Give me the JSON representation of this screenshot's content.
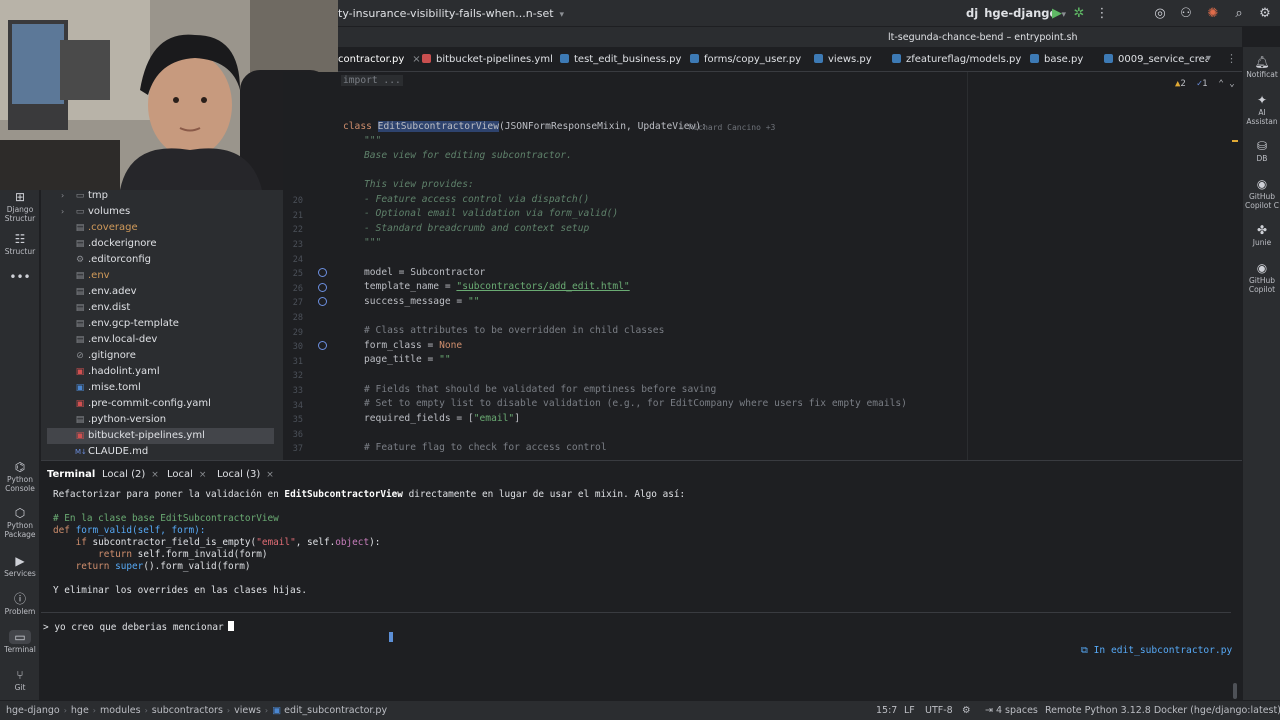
{
  "titlebar": {
    "branch": "ty-insurance-visibility-fails-when...n-set",
    "project_badge": "dj",
    "project": "hge-django",
    "run_config_hint": "lt-segunda-chance-bend – entrypoint.sh"
  },
  "file_tabs": [
    {
      "label": "contractor.py",
      "active": true
    },
    {
      "label": "bitbucket-pipelines.yml"
    },
    {
      "label": "test_edit_business.py"
    },
    {
      "label": "forms/copy_user.py"
    },
    {
      "label": "views.py"
    },
    {
      "label": "zfeatureflag/models.py"
    },
    {
      "label": "base.py"
    },
    {
      "label": "0009_service_crea"
    }
  ],
  "right_tools": [
    {
      "icon": "bell-icon",
      "label": "Notificat"
    },
    {
      "icon": "ai-assistant-icon",
      "label": "AI Assistan"
    },
    {
      "icon": "database-icon",
      "label": "DB"
    },
    {
      "icon": "copilot-icon",
      "label": "GitHub Copilot C"
    },
    {
      "icon": "junie-icon",
      "label": "Junie"
    },
    {
      "icon": "copilot-icon",
      "label": "GitHub Copilot"
    }
  ],
  "left_tools": [
    {
      "icon": "django-icon",
      "label": "Django Structur"
    },
    {
      "icon": "structure-icon",
      "label": "Structur"
    },
    {
      "icon": "more-icon",
      "label": ""
    },
    {
      "icon": "python-console-icon",
      "label": "Python Console"
    },
    {
      "icon": "python-package-icon",
      "label": "Python Package"
    },
    {
      "icon": "services-icon",
      "label": "Services"
    },
    {
      "icon": "problems-icon",
      "label": "Problem"
    },
    {
      "icon": "terminal-icon",
      "label": "Terminal"
    },
    {
      "icon": "git-icon",
      "label": "Git"
    }
  ],
  "tree": [
    {
      "label": "tmp",
      "type": "folder"
    },
    {
      "label": "volumes",
      "type": "folder"
    },
    {
      "label": ".coverage",
      "type": "file",
      "orange": true
    },
    {
      "label": ".dockerignore",
      "type": "file"
    },
    {
      "label": ".editorconfig",
      "type": "file"
    },
    {
      "label": ".env",
      "type": "file",
      "orange": true
    },
    {
      "label": ".env.adev",
      "type": "file"
    },
    {
      "label": ".env.dist",
      "type": "file"
    },
    {
      "label": ".env.gcp-template",
      "type": "file"
    },
    {
      "label": ".env.local-dev",
      "type": "file"
    },
    {
      "label": ".gitignore",
      "type": "file"
    },
    {
      "label": ".hadolint.yaml",
      "type": "file"
    },
    {
      "label": ".mise.toml",
      "type": "file"
    },
    {
      "label": ".pre-commit-config.yaml",
      "type": "file"
    },
    {
      "label": ".python-version",
      "type": "file"
    },
    {
      "label": "bitbucket-pipelines.yml",
      "type": "file",
      "selected": true
    },
    {
      "label": "CLAUDE.md",
      "type": "file"
    }
  ],
  "editor": {
    "import_fold": "import ...",
    "author": "Richard Cancino +3",
    "warnings": "2",
    "checks": "1",
    "line_numbers": [
      "20",
      "21",
      "22",
      "23",
      "24",
      "25",
      "26",
      "27",
      "28",
      "29",
      "30",
      "31",
      "32",
      "33",
      "34",
      "35",
      "36",
      "37"
    ],
    "class_kw": "class",
    "class_name": "EditSubcontractorView",
    "class_bases": "(JSONFormResponseMixin, UpdateView):",
    "doc_open": "\"\"\"",
    "doc_1": "Base view for editing subcontractor.",
    "doc_2": "This view provides:",
    "doc_3": "- Feature access control via dispatch()",
    "doc_4": "- Optional email validation via form_valid()",
    "doc_5": "- Standard breadcrumb and context setup",
    "doc_close": "\"\"\"",
    "model_line": "model = Subcontractor",
    "template_key": "template_name = ",
    "template_val": "\"subcontractors/add_edit.html\"",
    "success_key": "success_message = ",
    "success_val": "\"\"",
    "cmt_1": "# Class attributes to be overridden in child classes",
    "form_class_key": "form_class = ",
    "form_class_val": "None",
    "page_title_key": "page_title = ",
    "page_title_val": "\"\"",
    "cmt_2": "# Fields that should be validated for emptiness before saving",
    "cmt_3": "# Set to empty list to disable validation (e.g., for EditCompany where users fix empty emails)",
    "required_key": "required_fields = [",
    "required_val": "\"email\"",
    "required_end": "]",
    "cmt_4": "# Feature flag to check for access control"
  },
  "terminal": {
    "tabs": [
      "Terminal",
      "Local (2)",
      "Local",
      "Local (3)"
    ],
    "line_1a": "Refactorizar para poner la validación en ",
    "line_1b": "EditSubcontractorView",
    "line_1c": " directamente en lugar de usar el mixin. Algo así:",
    "code_1": "# En la clase base EditSubcontractorView",
    "code_2a": "def ",
    "code_2b": "form_valid(self, form):",
    "code_3a": "    if ",
    "code_3b": "subcontractor_field_is_empty(",
    "code_3c": "\"email\"",
    "code_3d": ", self.",
    "code_3e": "object",
    "code_3f": "):",
    "code_4a": "        return ",
    "code_4b": "self.form_invalid(form)",
    "code_5a": "    return ",
    "code_5b": "super",
    "code_5c": "().form_valid(form)",
    "line_after": "Y eliminar los overrides en las clases hijas.",
    "prompt_symbol": ">",
    "prompt_text": "yo creo que deberias mencionar",
    "context_file": "In edit_subcontractor.py"
  },
  "statusbar": {
    "crumbs": [
      "hge-django",
      "hge",
      "modules",
      "subcontractors",
      "views",
      "edit_subcontractor.py"
    ],
    "position": "15:7",
    "line_sep": "LF",
    "encoding": "UTF-8",
    "indent": "4 spaces",
    "interpreter": "Remote Python 3.12.8 Docker (hge/django:latest)"
  },
  "colors": {
    "bg": "#1e1f22",
    "panel": "#2b2d30",
    "keyword": "#cf8e6d",
    "string": "#6aab73",
    "comment": "#7a7e85",
    "link": "#56a8f5"
  }
}
